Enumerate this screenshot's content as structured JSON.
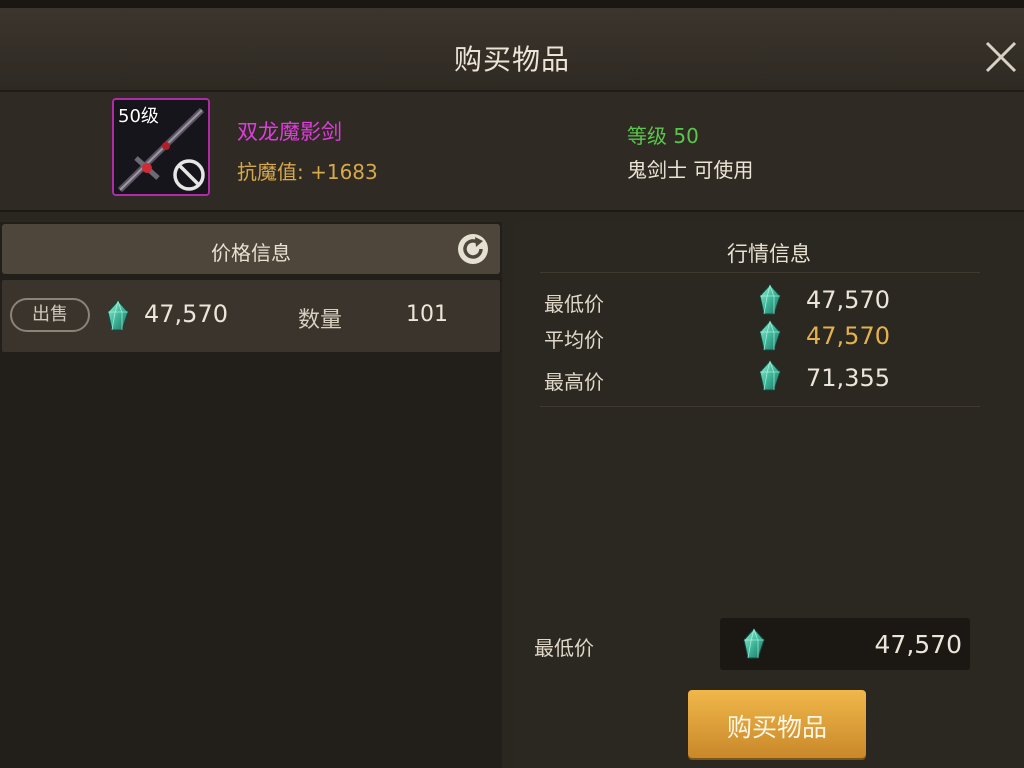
{
  "window": {
    "title": "购买物品"
  },
  "item": {
    "level_badge": "50级",
    "name": "双龙魔影剑",
    "resist_stat": "抗魔值: +1683",
    "required_level": "等级 50",
    "usable_by": "鬼剑士 可使用"
  },
  "price_info": {
    "header": "价格信息",
    "listings": [
      {
        "action_label": "出售",
        "price": "47,570",
        "quantity_label": "数量",
        "quantity": "101"
      }
    ]
  },
  "market_info": {
    "header": "行情信息",
    "rows": [
      {
        "label": "最低价",
        "value": "47,570"
      },
      {
        "label": "平均价",
        "value": "47,570"
      },
      {
        "label": "最高价",
        "value": "71,355"
      }
    ]
  },
  "purchase": {
    "price_label": "最低价",
    "price_value": "47,570",
    "buy_button_label": "购买物品"
  },
  "colors": {
    "item_name": "#e13cdf",
    "stat": "#d7a94b",
    "level_req": "#59c74b",
    "avg_price": "#e3b24c",
    "buy_button": "#e0a23c",
    "item_border": "#b12aa7"
  },
  "icons": [
    "close-icon",
    "refresh-icon",
    "gem-currency-icon",
    "no-use-icon",
    "sword-item-icon"
  ]
}
